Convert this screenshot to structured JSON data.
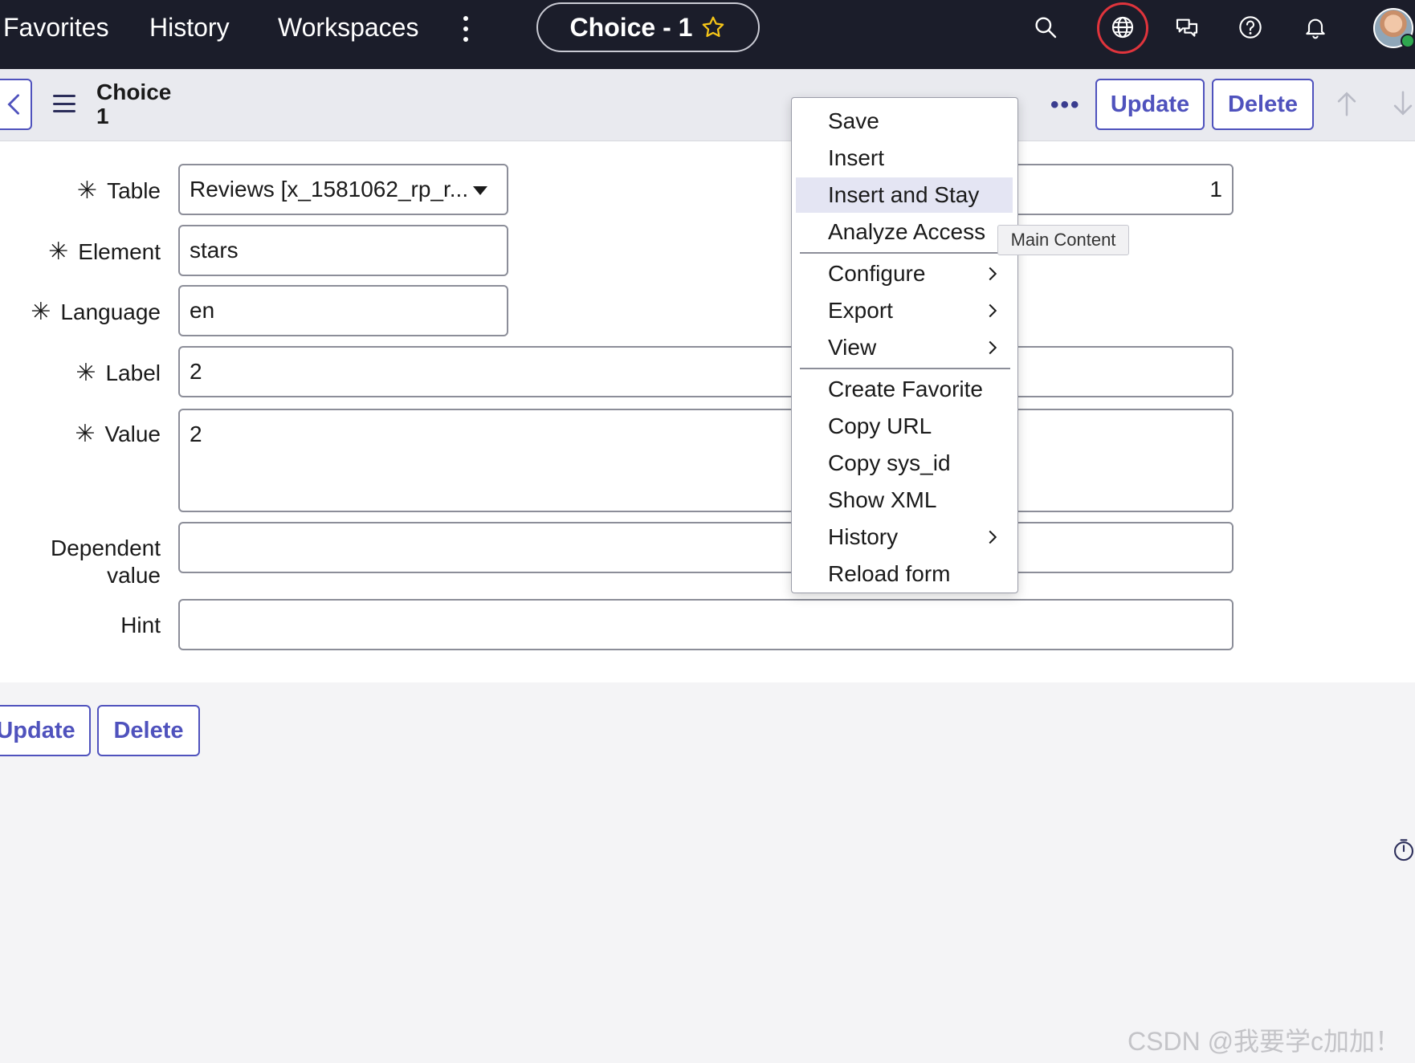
{
  "topnav": {
    "links": [
      "Favorites",
      "History",
      "Workspaces"
    ],
    "title": "Choice - 1",
    "icons": [
      "search-icon",
      "globe-icon",
      "chat-icon",
      "help-icon",
      "bell-icon"
    ]
  },
  "header": {
    "record_title": "Choice 1",
    "update_label": "Update",
    "delete_label": "Delete"
  },
  "form": {
    "fields": [
      {
        "label": "Table",
        "required": true,
        "value": "Reviews [x_1581062_rp_r...",
        "type": "select"
      },
      {
        "label": "Element",
        "required": true,
        "value": "stars",
        "type": "text"
      },
      {
        "label": "Language",
        "required": true,
        "value": "en",
        "type": "text"
      },
      {
        "label": "Label",
        "required": true,
        "value": "2",
        "type": "text"
      },
      {
        "label": "Value",
        "required": true,
        "value": "2",
        "type": "textarea"
      },
      {
        "label": "Dependent value",
        "required": false,
        "value": "",
        "type": "text"
      },
      {
        "label": "Hint",
        "required": false,
        "value": "",
        "type": "text"
      }
    ],
    "sequence_value": "1"
  },
  "context_menu": {
    "items": [
      {
        "label": "Save",
        "submenu": false,
        "active": false
      },
      {
        "label": "Insert",
        "submenu": false,
        "active": false
      },
      {
        "label": "Insert and Stay",
        "submenu": false,
        "active": true
      },
      {
        "label": "Analyze Access",
        "submenu": false,
        "active": false
      },
      {
        "label": "Configure",
        "submenu": true,
        "active": false
      },
      {
        "label": "Export",
        "submenu": true,
        "active": false
      },
      {
        "label": "View",
        "submenu": true,
        "active": false
      },
      {
        "label": "Create Favorite",
        "submenu": false,
        "active": false
      },
      {
        "label": "Copy URL",
        "submenu": false,
        "active": false
      },
      {
        "label": "Copy sys_id",
        "submenu": false,
        "active": false
      },
      {
        "label": "Show XML",
        "submenu": false,
        "active": false
      },
      {
        "label": "History",
        "submenu": true,
        "active": false
      },
      {
        "label": "Reload form",
        "submenu": false,
        "active": false
      }
    ],
    "tooltip": "Main Content"
  },
  "footer": {
    "update_label": "Update",
    "delete_label": "Delete"
  },
  "watermark": "CSDN @我要学c加加！",
  "colors": {
    "nav_bg": "#1b1d2a",
    "accent": "#4f52bd",
    "highlight_ring": "#e0343c",
    "star": "#f5c518"
  }
}
